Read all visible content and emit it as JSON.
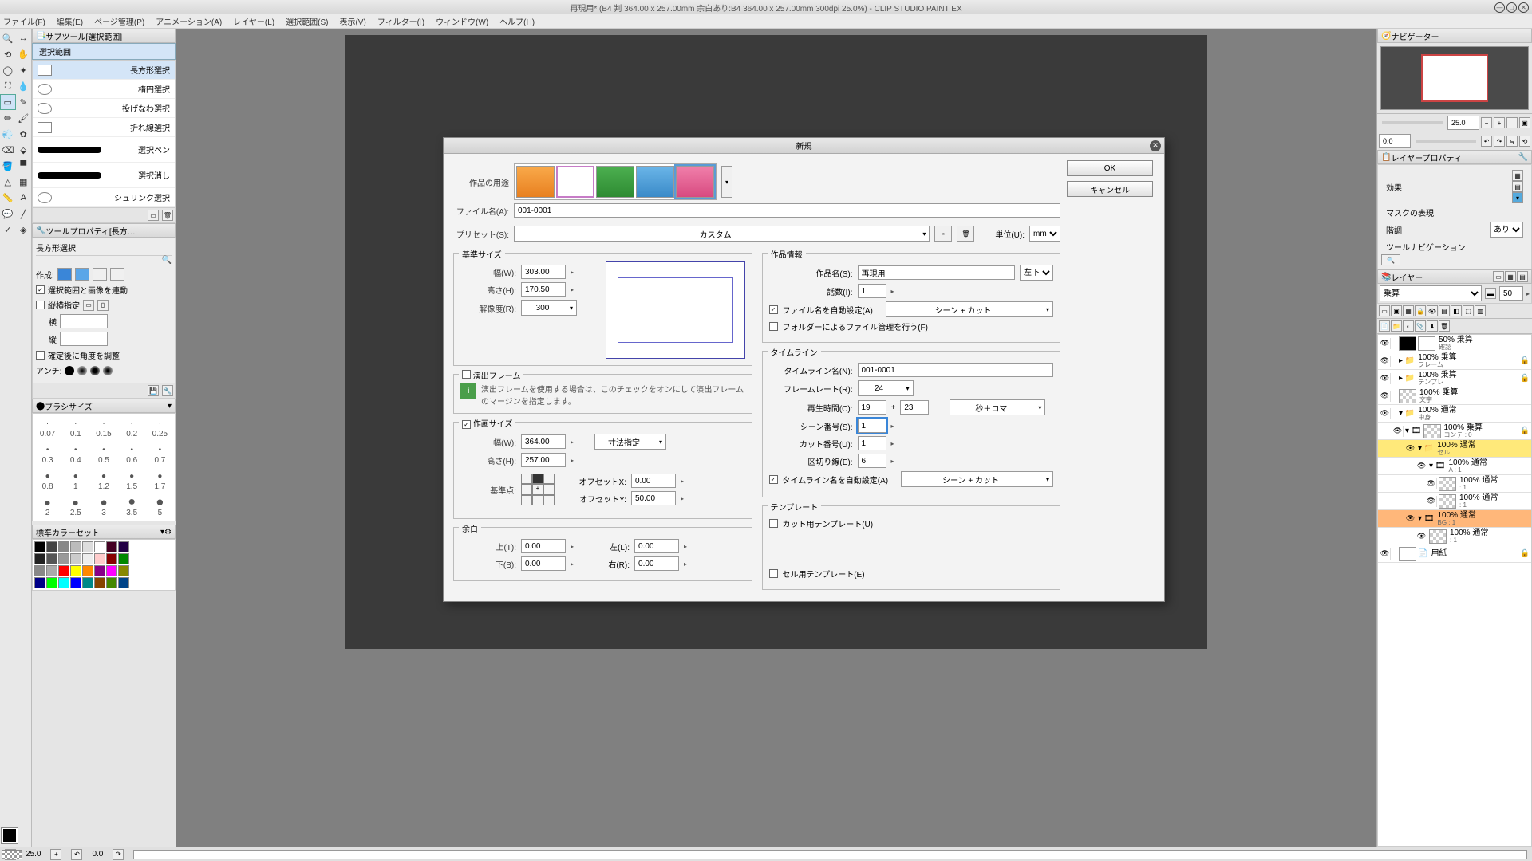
{
  "title": "再現用* (B4 判 364.00 x 257.00mm 余白あり:B4 364.00 x 257.00mm 300dpi 25.0%)  - CLIP STUDIO PAINT EX",
  "menu": [
    "ファイル(F)",
    "編集(E)",
    "ページ管理(P)",
    "アニメーション(A)",
    "レイヤー(L)",
    "選択範囲(S)",
    "表示(V)",
    "フィルター(I)",
    "ウィンドウ(W)",
    "ヘルプ(H)"
  ],
  "subtool": {
    "title": "サブツール[選択範囲]",
    "tab": "選択範囲",
    "items": [
      "長方形選択",
      "楕円選択",
      "投げなわ選択",
      "折れ線選択",
      "選択ペン",
      "選択消し",
      "シュリンク選択"
    ]
  },
  "toolprop": {
    "title": "ツールプロパティ[長方…",
    "subtitle": "長方形選択",
    "make": "作成:",
    "linksel": "選択範囲と画像を連動",
    "aspect": "縦横指定",
    "yoko": "横",
    "tate": "縦",
    "angle": "確定後に角度を調整",
    "anti": "アンチ:"
  },
  "brush": {
    "title": "ブラシサイズ",
    "sizes1": [
      "0.07",
      "0.1",
      "0.15",
      "0.2",
      "0.25"
    ],
    "sizes2": [
      "0.3",
      "0.4",
      "0.5",
      "0.6",
      "0.7"
    ],
    "sizes3": [
      "0.8",
      "1",
      "1.2",
      "1.5",
      "1.7"
    ],
    "sizes4": [
      "2",
      "2.5",
      "3",
      "3.5",
      "5"
    ]
  },
  "colorset": {
    "title": "標準カラーセット"
  },
  "navigator": {
    "title": "ナビゲーター",
    "zoom": "25.0",
    "angle": "0.0"
  },
  "layerprop": {
    "title": "レイヤープロパティ",
    "effect": "効果",
    "mask": "マスクの表現",
    "tone": "階調",
    "tone_val": "あり",
    "toolnav": "ツールナビゲーション"
  },
  "layers": {
    "title": "レイヤー",
    "blend": "乗算",
    "opacity": "50",
    "items": [
      {
        "n": "50% 乗算",
        "s": "確認"
      },
      {
        "n": "100% 乗算",
        "s": "フレーム"
      },
      {
        "n": "100% 乗算",
        "s": "テンプレ"
      },
      {
        "n": "100% 乗算",
        "s": "文字"
      },
      {
        "n": "100% 通常",
        "s": "中身"
      },
      {
        "n": "100% 乗算",
        "s": "コンテ : 0"
      },
      {
        "n": "100% 通常",
        "s": "セル"
      },
      {
        "n": "100% 通常",
        "s": "A : 1"
      },
      {
        "n": "100% 通常",
        "s": ": 1"
      },
      {
        "n": "100% 通常",
        "s": ": 1"
      },
      {
        "n": "100% 通常",
        "s": "BG : 1"
      },
      {
        "n": "100% 通常",
        "s": ": 1"
      },
      {
        "n": "用紙",
        "s": ""
      }
    ]
  },
  "status": {
    "zoom": "25.0",
    "angle": "0.0"
  },
  "dialog": {
    "title": "新規",
    "ok": "OK",
    "cancel": "キャンセル",
    "usage": "作品の用途",
    "filename": "ファイル名(A):",
    "filename_v": "001-0001",
    "preset": "プリセット(S):",
    "preset_v": "カスタム",
    "unit": "単位(U):",
    "unit_v": "mm",
    "base": {
      "legend": "基準サイズ",
      "w": "幅(W):",
      "w_v": "303.00",
      "h": "高さ(H):",
      "h_v": "170.50",
      "dpi": "解像度(R):",
      "dpi_v": "300"
    },
    "render": {
      "legend": "演出フレーム",
      "note": "演出フレームを使用する場合は、このチェックをオンにして演出フレームのマージンを指定します。"
    },
    "drawsize": {
      "legend": "作画サイズ",
      "w": "幅(W):",
      "w_v": "364.00",
      "h": "高さ(H):",
      "h_v": "257.00",
      "dims": "寸法指定",
      "anchor": "基準点:",
      "offx": "オフセットX:",
      "offx_v": "0.00",
      "offy": "オフセットY:",
      "offy_v": "50.00"
    },
    "margin": {
      "legend": "余白",
      "t": "上(T):",
      "t_v": "0.00",
      "b": "下(B):",
      "b_v": "0.00",
      "l": "左(L):",
      "l_v": "0.00",
      "r": "右(R):",
      "r_v": "0.00"
    },
    "info": {
      "legend": "作品情報",
      "name": "作品名(S):",
      "name_v": "再現用",
      "pos": "左下",
      "ep": "話数(I):",
      "ep_v": "1",
      "autoname": "ファイル名を自動設定(A)",
      "autoname_v": "シーン + カット",
      "folder": "フォルダーによるファイル管理を行う(F)"
    },
    "timeline": {
      "legend": "タイムライン",
      "name": "タイムライン名(N):",
      "name_v": "001-0001",
      "fps": "フレームレート(R):",
      "fps_v": "24",
      "play": "再生時間(C):",
      "play_v1": "19",
      "plus": "+",
      "play_v2": "23",
      "play_unit": "秒＋コマ",
      "scene": "シーン番号(S):",
      "scene_v": "1",
      "cut": "カット番号(U):",
      "cut_v": "1",
      "div": "区切り線(E):",
      "div_v": "6",
      "autoname": "タイムライン名を自動設定(A)",
      "autoname_v": "シーン + カット"
    },
    "template": {
      "legend": "テンプレート",
      "cut": "カット用テンプレート(U)",
      "cel": "セル用テンプレート(E)"
    }
  }
}
